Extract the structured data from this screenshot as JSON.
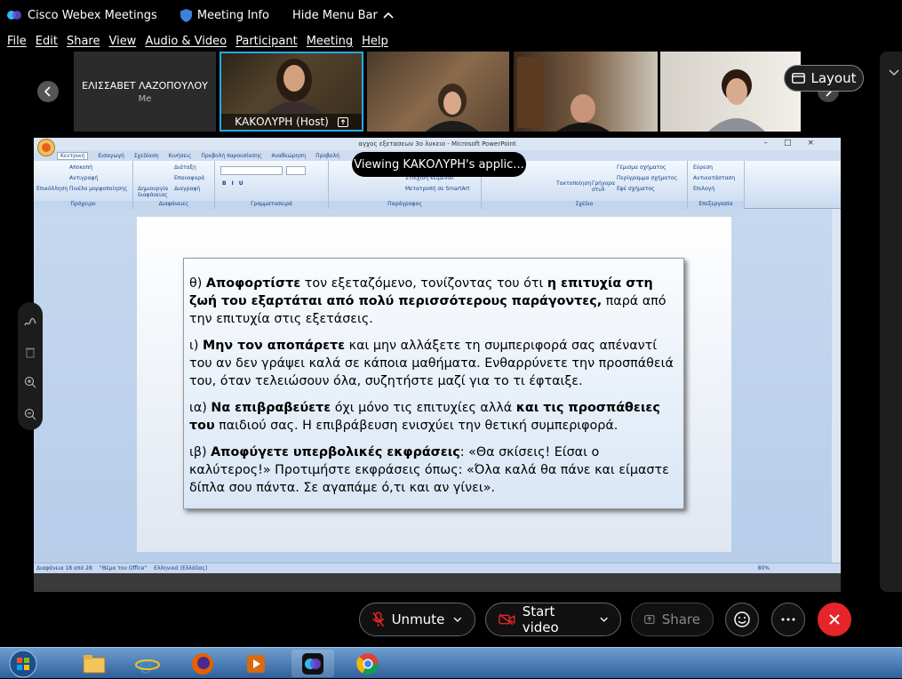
{
  "window": {
    "app_title": "Cisco Webex Meetings",
    "meeting_info": "Meeting Info",
    "hide_menu_bar": "Hide Menu Bar"
  },
  "menu": [
    "File",
    "Edit",
    "Share",
    "View",
    "Audio & Video",
    "Participant",
    "Meeting",
    "Help"
  ],
  "participants": {
    "first": {
      "name": "ΕΛΙΣΣΑΒΕΤ ΛΑΖΟΠΟΥΛΟΥ",
      "role": "Me"
    },
    "host": {
      "label": "ΚΑΚΟΛΥΡΗ  (Host)"
    }
  },
  "layout_button": "Layout",
  "viewing_banner": "Viewing ΚΑΚΟΛΥΡΗ's applic...",
  "ppt": {
    "title": "αγχος εξετασεων 3ο λυκειο - Microsoft PowerPoint",
    "tabs": [
      "Κεντρική",
      "Εισαγωγή",
      "Σχεδίαση",
      "Κινήσεις",
      "Προβολή παρουσίασης",
      "Αναθεώρηση",
      "Προβολή"
    ],
    "groups": [
      "Πρόχειρο",
      "Διαφάνειες",
      "Γραμματοσειρά",
      "Παράγραφος",
      "Σχέδιο",
      "Επεξεργασία"
    ],
    "clipboard": [
      "Επικόλληση",
      "Αποκοπή",
      "Αντιγραφή",
      "Πινέλο μορφοποίησης"
    ],
    "slides_grp": [
      "Δημιουργία διαφάνειας",
      "Διάταξη",
      "Επαναφορά",
      "Διαγραφή"
    ],
    "drawing_grp": [
      "Τακτοποίηση",
      "Γρήγορα στυλ",
      "Γέμισμα σχήματος",
      "Περίγραμμα σχήματος",
      "Εφέ σχήματος"
    ],
    "editing_grp": [
      "Εύρεση",
      "Αντικατάσταση",
      "Επιλογή"
    ],
    "paragraph_grp": [
      "Στοίχιση κειμένου",
      "Μετατροπή σε SmartArt"
    ],
    "status": {
      "slide": "Διαφάνεια 18 από 28",
      "theme": "\"Θέμα του Office\"",
      "lang": "Ελληνικά (Ελλάδας)",
      "zoom": "80%"
    }
  },
  "slide": {
    "paras": [
      {
        "prefix": "θ) ",
        "b1": "Αποφορτίστε",
        "t1": " τον εξεταζόμενο, τονίζοντας του ότι ",
        "b2": "η επιτυχία στη ζωή του εξαρτάται από πολύ περισσότερους παράγοντες,",
        "t2": " παρά από την επιτυχία στις εξετάσεις."
      },
      {
        "prefix": "ι) ",
        "b1": "Μην τον αποπάρετε",
        "t1": "  και μην αλλάξετε τη συμπεριφορά σας απέναντί του αν δεν γράψει καλά σε κάποια μαθήματα. Ενθαρρύνετε την προσπάθειά του, όταν τελειώσουν όλα, συζητήστε μαζί για το τι έφταιξε.",
        "b2": "",
        "t2": ""
      },
      {
        "prefix": "ια) ",
        "b1": "Να επιβραβεύετε",
        "t1": " όχι μόνο τις επιτυχίες αλλά ",
        "b2": "και τις προσπάθειες του",
        "t2": " παιδιού σας. Η επιβράβευση ενισχύει την θετική συμπεριφορά."
      },
      {
        "prefix": "ιβ) ",
        "b1": "Αποφύγετε υπερβολικές εκφράσεις",
        "t1": ": «Θα σκίσεις! Είσαι ο καλύτερος!» Προτιμήστε εκφράσεις όπως: «Όλα καλά θα πάνε και είμαστε δίπλα σου πάντα. Σε αγαπάμε ό,τι και αν γίνει».",
        "b2": "",
        "t2": ""
      }
    ]
  },
  "controls": {
    "unmute": "Unmute",
    "start_video": "Start video",
    "share": "Share"
  },
  "colors": {
    "accent_blue": "#29a9e6",
    "end_red": "#e5252a",
    "share_bg": "#c5d8ef"
  }
}
